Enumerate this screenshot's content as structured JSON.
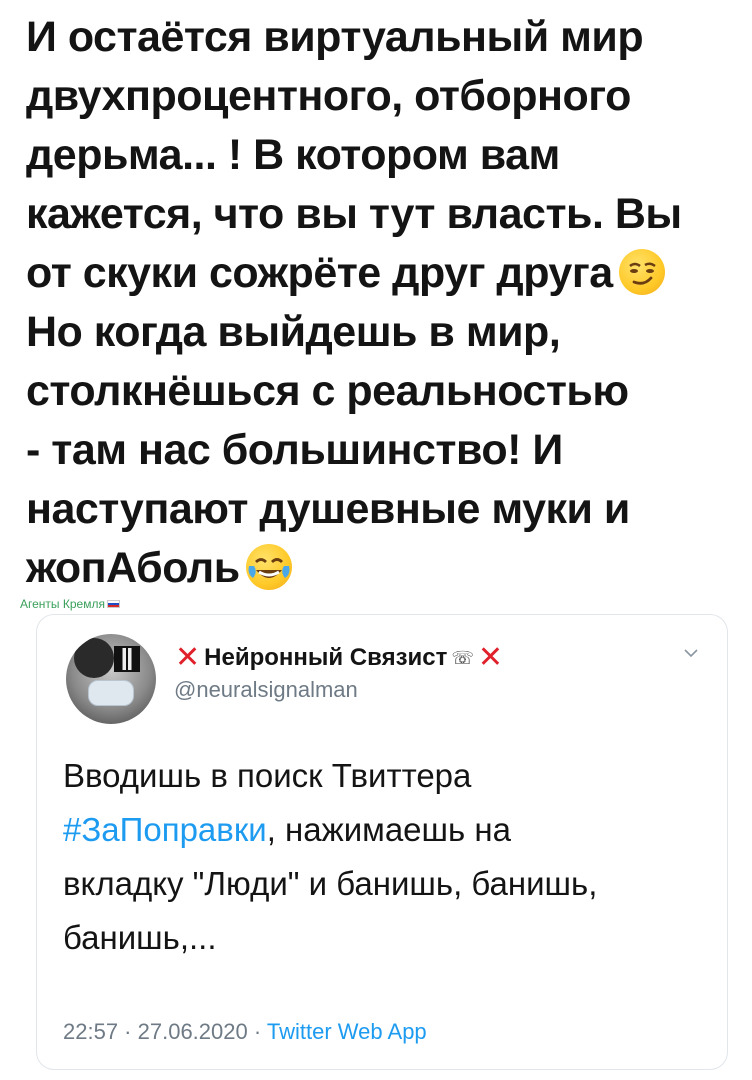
{
  "headline": {
    "lines": [
      "И остаётся виртуальный мир",
      "двухпроцентного, отборного",
      "дерьма... ! В котором вам",
      "кажется, что вы тут власть. Вы",
      "от скуки сожрёте друг друга",
      "Но когда выйдешь в мир,",
      "столкнёшься с реальностью",
      " - там нас большинство! И",
      "наступают душевные муки и",
      "жопАболь"
    ],
    "emojis": [
      "smirking-face",
      "face-with-tears-of-joy"
    ]
  },
  "watermark": {
    "text": "Агенты Кремля"
  },
  "quoted_tweet": {
    "display_name": "Нейронный Связист",
    "name_decor_left": "✕",
    "name_decor_right": "✕",
    "phone_glyph": "☏",
    "handle": "@neuralsignalman",
    "body": {
      "line1": "Вводишь в поиск Твиттера",
      "hashtag": "#ЗаПоправки",
      "line2_rest": ", нажимаешь на",
      "line3": "вкладку \"Люди\" и банишь, банишь,",
      "line4": "банишь,..."
    },
    "time": "22:57",
    "separator": " · ",
    "date": "27.06.2020",
    "source": "Twitter Web App"
  },
  "colors": {
    "link": "#1d9bf0",
    "cross": "#e0202a",
    "muted": "#6e7a85",
    "watermark": "#3aa05a"
  }
}
